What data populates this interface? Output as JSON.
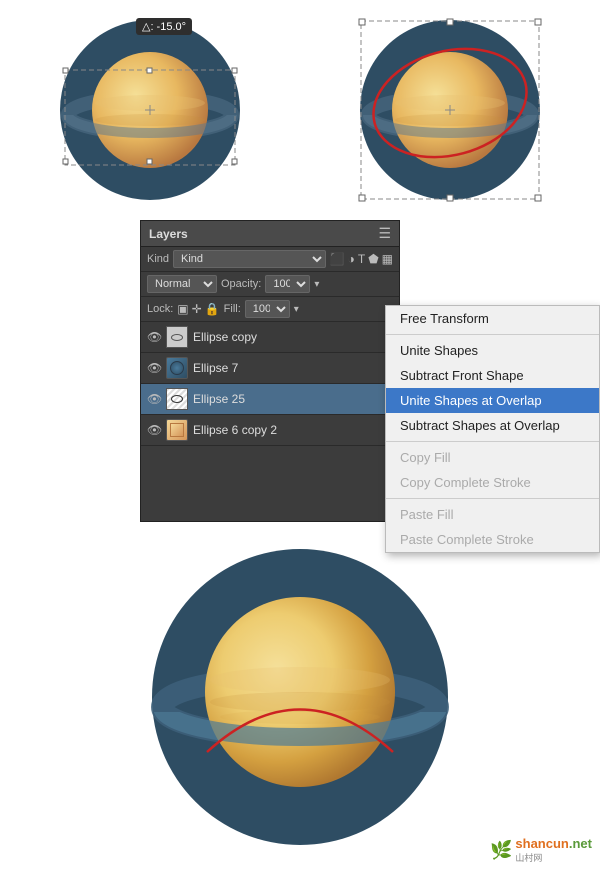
{
  "topLeft": {
    "badge": "△: -15.0°"
  },
  "layersPanel": {
    "title": "Layers",
    "kindLabel": "Kind",
    "modeLabel": "Normal",
    "opacity": "100%",
    "lockLabel": "Lock:",
    "fill": "100%",
    "layers": [
      {
        "name": "Ellipse copy",
        "type": "ellipse-copy",
        "visible": true,
        "selected": false
      },
      {
        "name": "Ellipse 7",
        "type": "ellipse7",
        "visible": true,
        "selected": false
      },
      {
        "name": "Ellipse 25",
        "type": "ellipse25",
        "visible": true,
        "selected": true
      },
      {
        "name": "Ellipse 6 copy 2",
        "type": "ellipse6c2",
        "visible": true,
        "selected": false
      }
    ]
  },
  "contextMenu": {
    "items": [
      {
        "label": "Free Transform",
        "disabled": false,
        "highlighted": false,
        "dividerAfter": true
      },
      {
        "label": "Unite Shapes",
        "disabled": false,
        "highlighted": false,
        "dividerAfter": false
      },
      {
        "label": "Subtract Front Shape",
        "disabled": false,
        "highlighted": false,
        "dividerAfter": false
      },
      {
        "label": "Unite Shapes at Overlap",
        "disabled": false,
        "highlighted": true,
        "dividerAfter": false
      },
      {
        "label": "Subtract Shapes at Overlap",
        "disabled": false,
        "highlighted": false,
        "dividerAfter": true
      },
      {
        "label": "Copy Fill",
        "disabled": true,
        "highlighted": false,
        "dividerAfter": false
      },
      {
        "label": "Copy Complete Stroke",
        "disabled": true,
        "highlighted": false,
        "dividerAfter": true
      },
      {
        "label": "Paste Fill",
        "disabled": true,
        "highlighted": false,
        "dividerAfter": false
      },
      {
        "label": "Paste Complete Stroke",
        "disabled": true,
        "highlighted": false,
        "dividerAfter": false
      }
    ]
  },
  "watermark": {
    "text": "shancun",
    "sub": "山村网",
    "url": "shancun.net"
  }
}
